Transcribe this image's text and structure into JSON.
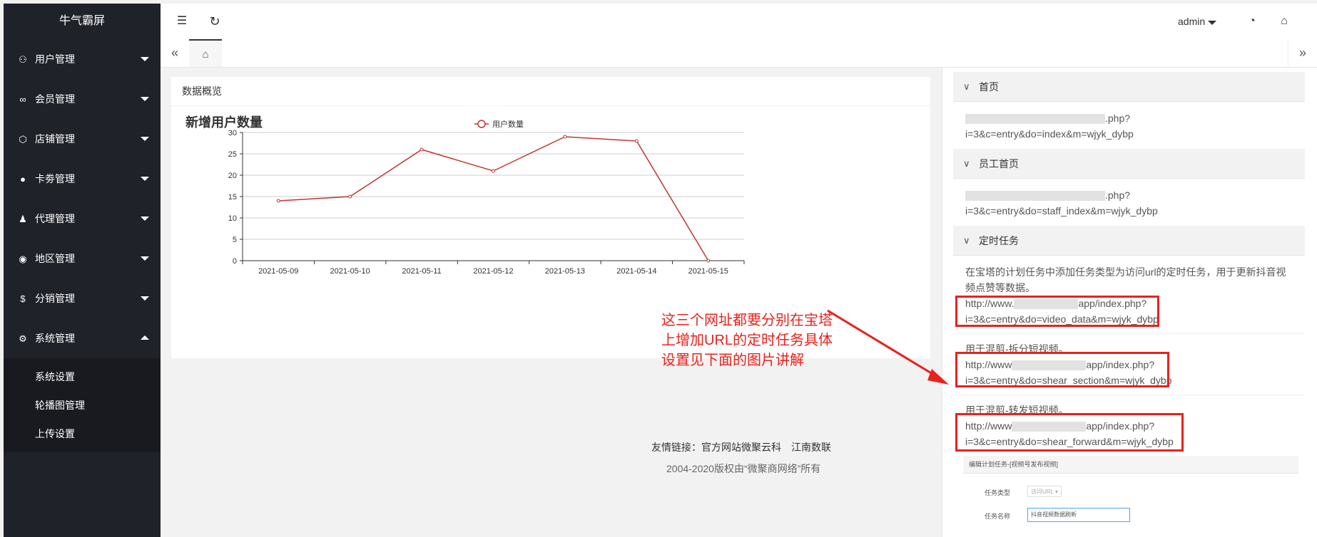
{
  "brand": "牛气霸屏",
  "sidebar": {
    "items": [
      {
        "label": "用户管理",
        "icon": "user-icon",
        "glyph": "⚇",
        "expanded": false
      },
      {
        "label": "会员管理",
        "icon": "link-icon",
        "glyph": "∞",
        "expanded": false
      },
      {
        "label": "店铺管理",
        "icon": "cube-icon",
        "glyph": "⬡",
        "expanded": false
      },
      {
        "label": "卡劵管理",
        "icon": "circle-icon",
        "glyph": "●",
        "expanded": false
      },
      {
        "label": "代理管理",
        "icon": "person-icon",
        "glyph": "♟",
        "expanded": false
      },
      {
        "label": "地区管理",
        "icon": "compass-icon",
        "glyph": "◉",
        "expanded": false
      },
      {
        "label": "分销管理",
        "icon": "dollar-icon",
        "glyph": "$",
        "expanded": false
      },
      {
        "label": "系统管理",
        "icon": "gear-icon",
        "glyph": "⚙",
        "expanded": true
      }
    ],
    "submenu": [
      "系统设置",
      "轮播图管理",
      "上传设置"
    ]
  },
  "header": {
    "menu_icon": "☰",
    "refresh_icon": "↻",
    "user": "admin",
    "theme_icon": "◔",
    "tag_icon": "⌂"
  },
  "tabs": {
    "prev": "«",
    "home": "⌂",
    "next": "»"
  },
  "card": {
    "title": "数据概览"
  },
  "chart_data": {
    "type": "line",
    "title": "新增用户数量",
    "series": [
      {
        "name": "用户数量",
        "values": [
          14,
          15,
          26,
          21,
          29,
          28,
          0
        ],
        "color": "#c23531"
      }
    ],
    "x": [
      "2021-05-09",
      "2021-05-10",
      "2021-05-11",
      "2021-05-12",
      "2021-05-13",
      "2021-05-14",
      "2021-05-15"
    ],
    "ylim": [
      0,
      30
    ],
    "yticks": [
      0,
      5,
      10,
      15,
      20,
      25,
      30
    ],
    "grid": true,
    "legend": "top-center"
  },
  "footer": {
    "links_label": "友情链接：官方网站微聚云科",
    "link2": "江南数联",
    "copyright": "2004-2020版权由“微聚商网络”所有"
  },
  "rpanel": {
    "sections": [
      {
        "title": "首页",
        "lines": [
          ".php?",
          "i=3&c=entry&do=index&m=wjyk_dybp"
        ]
      },
      {
        "title": "员工首页",
        "lines": [
          ".php?",
          "i=3&c=entry&do=staff_index&m=wjyk_dybp"
        ]
      },
      {
        "title": "定时任务",
        "desc1": "在宝塔的计划任务中添加任务类型为访问url的定时任务，用于更新抖音视",
        "desc2": "频点赞等数据。"
      }
    ],
    "tasks": [
      {
        "prefix": "http://www.",
        "suffix": "app/index.php?",
        "line2": "i=3&c=entry&do=video_data&m=wjyk_dybp"
      },
      {
        "note": "用于混剪-拆分短视频。",
        "prefix": "http://www",
        "suffix": "app/index.php?",
        "line2": "i=3&c=entry&do=shear_section&m=wjyk_dybp"
      },
      {
        "note": "用于混剪-转发短视频。",
        "prefix": "http://www",
        "suffix": "app/index.php?",
        "line2": "i=3&c=entry&do=shear_forward&m=wjyk_dybp"
      }
    ]
  },
  "annotation": {
    "text": "这三个网址都要分别在宝塔上增加URL的定时任务具体设置见下面的图片讲解",
    "color": "#e8221c"
  },
  "embed": {
    "title": "编辑计划任务-[视频号发布视频]",
    "type_label": "任务类型",
    "type_value": "访问URL ▾",
    "name_label": "任务名称",
    "name_value": "抖音视频数据刷新"
  }
}
